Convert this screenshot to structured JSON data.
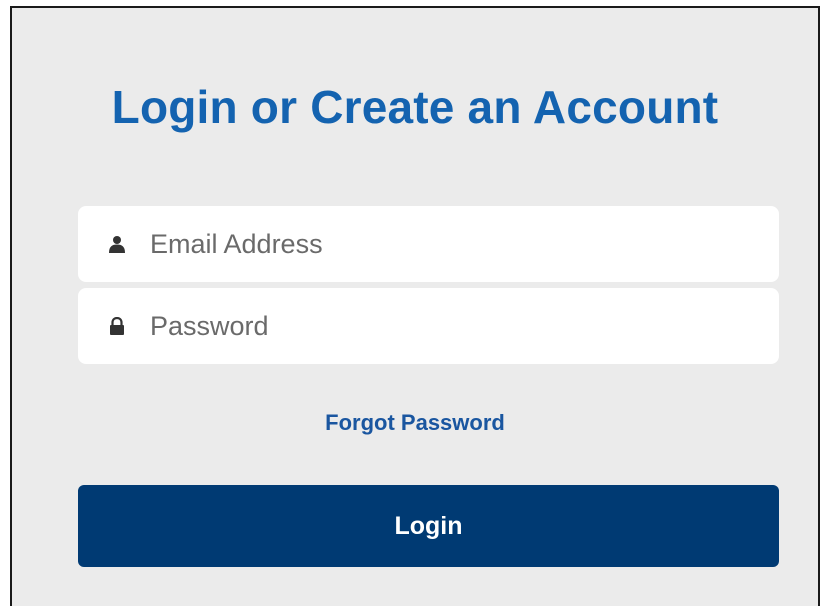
{
  "login": {
    "title": "Login or Create an Account",
    "email": {
      "placeholder": "Email Address",
      "value": "",
      "icon": "user-icon"
    },
    "password": {
      "placeholder": "Password",
      "value": "",
      "icon": "lock-icon"
    },
    "forgot_label": "Forgot Password",
    "submit_label": "Login"
  },
  "colors": {
    "panel_bg": "#ebebeb",
    "title": "#1463b0",
    "link": "#1a56a0",
    "button_bg": "#003a73",
    "button_text": "#ffffff",
    "icon": "#333333"
  }
}
